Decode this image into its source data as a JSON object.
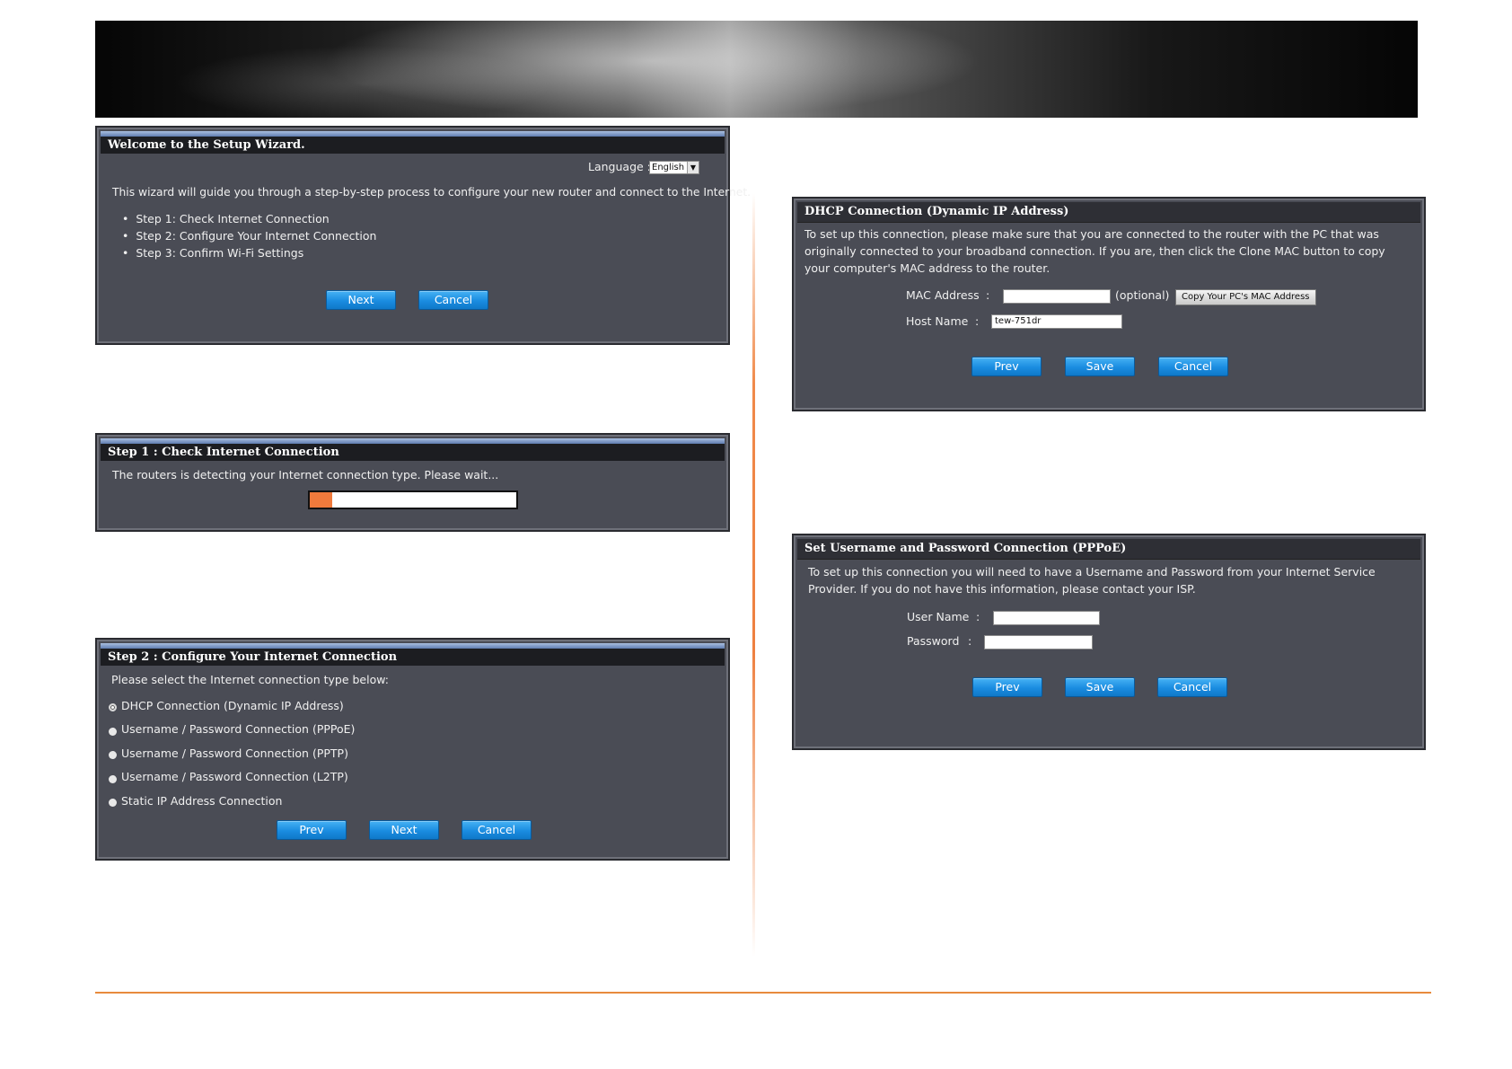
{
  "wizard": {
    "title": "Welcome to the Setup Wizard.",
    "language_label": "Language :",
    "language_value": "English",
    "intro": "This wizard will guide you through a step-by-step process to configure your new router and connect to the Internet.",
    "steps": [
      "Step 1: Check Internet Connection",
      "Step 2: Configure Your Internet Connection",
      "Step 3: Confirm Wi-Fi Settings"
    ],
    "next_label": "Next",
    "cancel_label": "Cancel"
  },
  "step1": {
    "title": "Step 1 : Check Internet Connection",
    "message": "The routers is detecting your Internet connection type. Please wait...",
    "progress": 0.11
  },
  "step2": {
    "title": "Step 2 : Configure Your Internet Connection",
    "instruction": "Please select the Internet connection type below:",
    "options": [
      "DHCP Connection (Dynamic IP Address)",
      "Username / Password Connection (PPPoE)",
      "Username / Password Connection (PPTP)",
      "Username / Password Connection (L2TP)",
      "Static IP Address Connection"
    ],
    "selected_index": 0,
    "prev_label": "Prev",
    "next_label": "Next",
    "cancel_label": "Cancel"
  },
  "dhcp": {
    "title": "DHCP Connection (Dynamic IP Address)",
    "description": "To set up this connection, please make sure that you are connected to the router with the PC that was originally connected to your broadband connection. If you are, then click the Clone MAC button to copy your computer's MAC address to the router.",
    "mac_label": "MAC Address",
    "host_label": "Host Name",
    "colon": ":",
    "mac_value": "",
    "optional": "(optional)",
    "copy_mac_label": "Copy Your PC's MAC Address",
    "host_value": "tew-751dr",
    "prev_label": "Prev",
    "save_label": "Save",
    "cancel_label": "Cancel"
  },
  "pppoe": {
    "title": "Set Username and Password Connection (PPPoE)",
    "description": "To set up this connection you will need to have a Username and Password from your Internet Service Provider. If you do not have this information, please contact your ISP.",
    "username_label": "User Name",
    "password_label": "Password",
    "colon": ":",
    "username_value": "",
    "password_value": "",
    "prev_label": "Prev",
    "save_label": "Save",
    "cancel_label": "Cancel"
  },
  "colors": {
    "panel_bg": "#4a4c55",
    "button_blue": "#1a8ce0",
    "progress_orange": "#f07a3c",
    "accent_orange": "#e88a3c"
  }
}
